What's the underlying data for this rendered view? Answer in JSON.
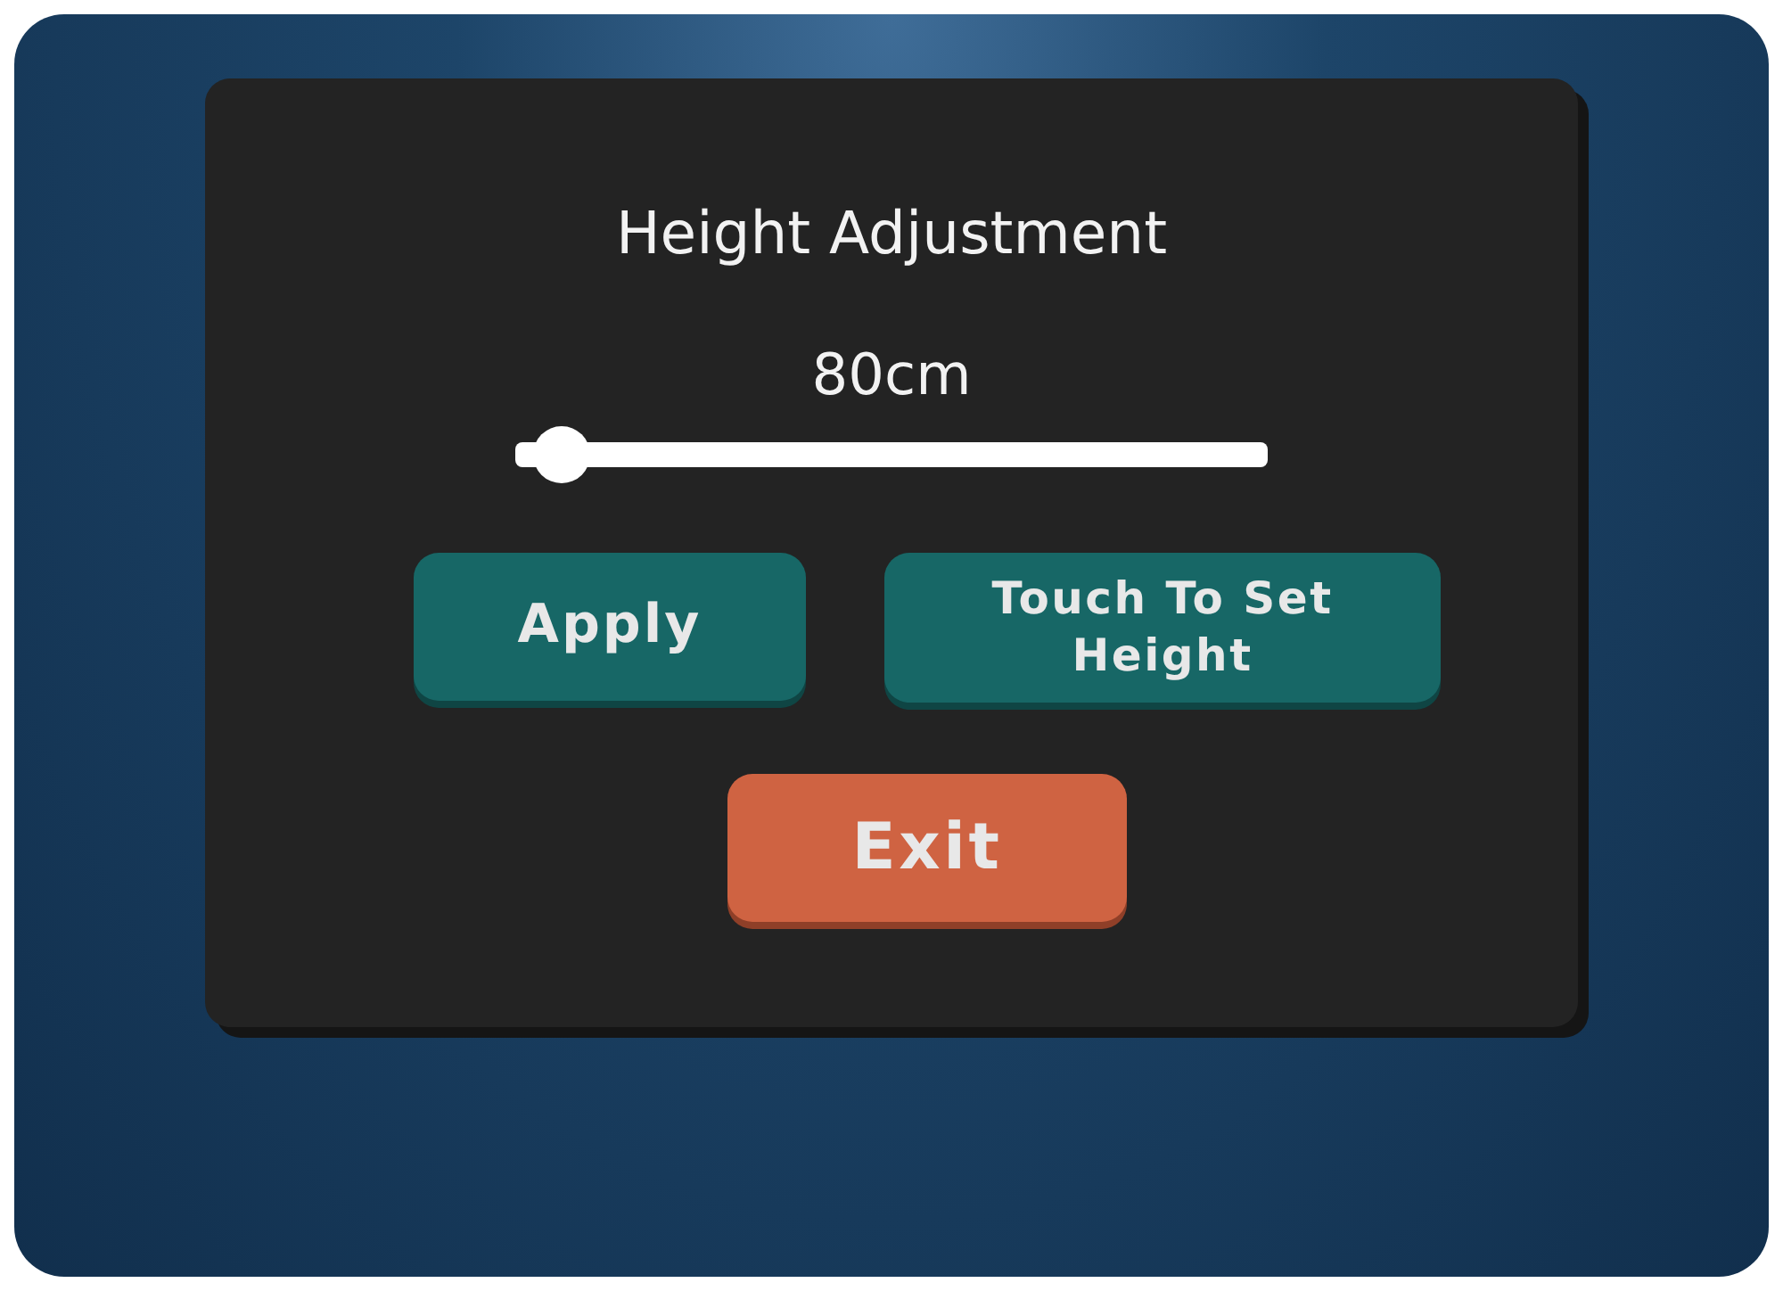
{
  "panel": {
    "title": "Height Adjustment"
  },
  "height_slider": {
    "reading": "80cm",
    "level": 0.03
  },
  "buttons": [
    {
      "label": "Apply",
      "kind": "primary"
    },
    {
      "label": "Touch To Set Height",
      "kind": "primary"
    },
    {
      "label": "Exit",
      "kind": "danger"
    }
  ]
}
